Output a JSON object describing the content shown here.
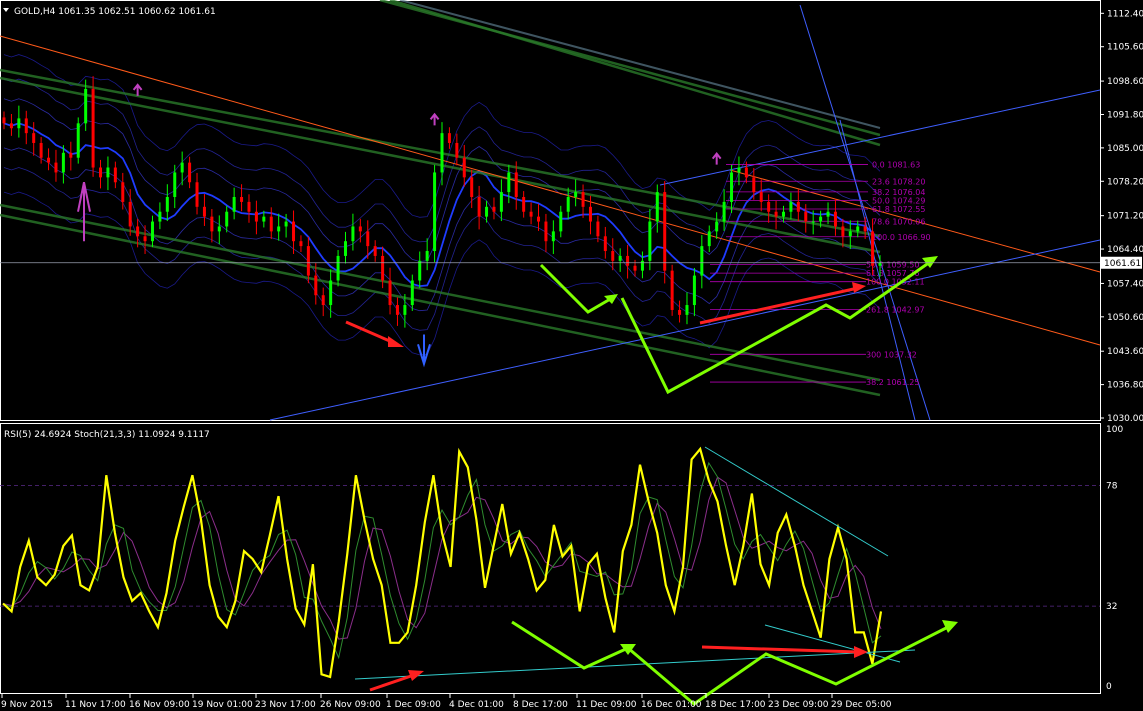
{
  "main_panel": {
    "header": "GOLD,H4  1061.35 1062.51 1060.62 1061.61",
    "price_axis": [
      "1112.40",
      "1105.60",
      "1098.60",
      "1091.80",
      "1085.00",
      "1078.20",
      "1071.20",
      "1064.40",
      "1057.40",
      "1050.60",
      "1043.60",
      "1036.80",
      "1030.00"
    ],
    "current_price": "1061.61",
    "fibo_levels": [
      "0.0 1081.63",
      "23.6 1078.20",
      "38.2 1076.04",
      "50.0 1074.29",
      "61.8 1072.55",
      "78.6 1070.06",
      "100.0 1066.90",
      "38.2 1061.25",
      "50.0 1059.50",
      "61.8 1057.76",
      "100.0 1052.11",
      "261.8 1042.97",
      "300 1037.32"
    ]
  },
  "sub_panel": {
    "header": "RSI(5) 24.6924  Stoch(21,3,3) 11.0924 9.1117",
    "axis": [
      "100",
      "78",
      "32",
      "0"
    ]
  },
  "time_axis": [
    "9 Nov 2015",
    "11 Nov 17:00",
    "16 Nov 09:00",
    "19 Nov 01:00",
    "23 Nov 17:00",
    "26 Nov 09:00",
    "1 Dec 09:00",
    "4 Dec 01:00",
    "8 Dec 17:00",
    "11 Dec 09:00",
    "16 Dec 01:00",
    "18 Dec 17:00",
    "23 Dec 09:00",
    "29 Dec 05:00"
  ],
  "colors": {
    "background": "#000000",
    "bull_candle": "#00ff00",
    "bear_candle": "#ff0000",
    "rsi": "#ffff00",
    "stoch_main": "#2e8b2e",
    "stoch_signal": "#8b2e8b",
    "fibo": "#b000b0",
    "trend_orange": "#ff5a1a",
    "trend_blue": "#3f5fff",
    "envelope_green": "#2a7a2a",
    "arrow_lime": "#7fff00",
    "arrow_red": "#ff2020",
    "trend_cyan": "#33cccc"
  },
  "chart_data": [
    {
      "type": "candlestick",
      "symbol": "GOLD",
      "timeframe": "H4",
      "last_bar": {
        "open": 1061.35,
        "high": 1062.51,
        "low": 1060.62,
        "close": 1061.61
      },
      "ylim": [
        1030.0,
        1114.5
      ],
      "approx_closes": [
        1090,
        1089,
        1091,
        1088,
        1086,
        1083,
        1082,
        1080,
        1084,
        1083,
        1090,
        1097,
        1081,
        1079,
        1081,
        1078,
        1074,
        1069,
        1067,
        1066,
        1070,
        1072,
        1075,
        1080,
        1082,
        1078,
        1073,
        1071,
        1068,
        1069,
        1072,
        1075,
        1074,
        1072,
        1070,
        1071,
        1068,
        1069,
        1070,
        1066,
        1065,
        1059,
        1055,
        1053,
        1058,
        1063,
        1066,
        1069,
        1068,
        1065,
        1063,
        1058,
        1053,
        1051,
        1053,
        1058,
        1062,
        1064,
        1080,
        1088,
        1086,
        1083,
        1079,
        1075,
        1071,
        1073,
        1072,
        1076,
        1080,
        1075,
        1072,
        1071,
        1070,
        1066,
        1068,
        1072,
        1075,
        1076,
        1073,
        1070,
        1067,
        1064,
        1062,
        1063,
        1061,
        1060,
        1062,
        1070,
        1076,
        1060,
        1052,
        1051,
        1053,
        1059,
        1065,
        1068,
        1070,
        1074,
        1080,
        1081,
        1079,
        1076,
        1074,
        1072,
        1071,
        1072,
        1074,
        1072,
        1070,
        1070,
        1071,
        1072,
        1069,
        1067,
        1068,
        1069,
        1068,
        1061,
        1061.61
      ],
      "fibo_retracement": {
        "0.0": 1081.63,
        "23.6": 1078.2,
        "38.2": 1076.04,
        "50.0": 1074.29,
        "61.8": 1072.55,
        "78.6": 1070.06,
        "100.0": 1066.9
      },
      "fibo_expansion": {
        "38.2": 1061.25,
        "50.0": 1059.5,
        "61.8": 1057.76,
        "100.0": 1052.11,
        "261.8": 1042.97,
        "300": 1037.32
      }
    },
    {
      "type": "line",
      "series": [
        {
          "name": "RSI(5)",
          "last": 24.6924
        },
        {
          "name": "Stoch(21,3,3)",
          "last": [
            11.0924,
            9.1117
          ]
        }
      ],
      "levels": [
        78,
        32
      ],
      "ylim": [
        0,
        100
      ],
      "approx_rsi": [
        33,
        30,
        47,
        57,
        43,
        40,
        44,
        55,
        59,
        40,
        38,
        47,
        82,
        60,
        43,
        34,
        37,
        30,
        24,
        37,
        57,
        70,
        82,
        65,
        40,
        28,
        24,
        34,
        53,
        50,
        45,
        59,
        74,
        50,
        31,
        25,
        48,
        6,
        5,
        26,
        52,
        82,
        65,
        50,
        40,
        18,
        18,
        22,
        40,
        64,
        82,
        60,
        47,
        91,
        85,
        65,
        39,
        55,
        71,
        52,
        60,
        50,
        38,
        42,
        63,
        51,
        55,
        30,
        48,
        52,
        35,
        22,
        53,
        63,
        86,
        72,
        60,
        40,
        30,
        47,
        88,
        92,
        80,
        72,
        55,
        40,
        55,
        75,
        48,
        40,
        60,
        67,
        55,
        40,
        30,
        20,
        50,
        62,
        50,
        22,
        22,
        10,
        30
      ]
    }
  ]
}
